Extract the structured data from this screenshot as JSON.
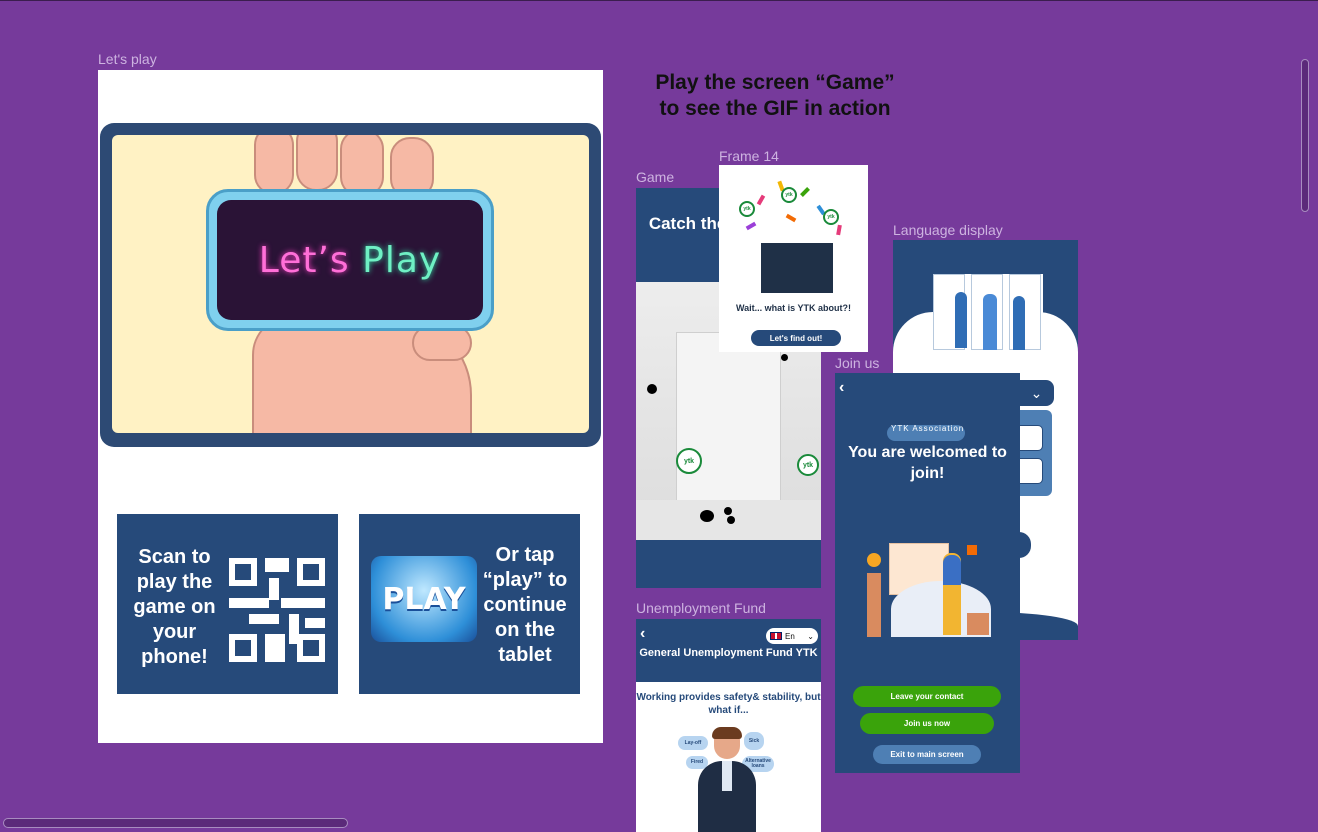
{
  "canvas": {
    "labels": {
      "lets_play": "Let's play",
      "frame14": "Frame 14",
      "game": "Game",
      "language_display": "Language display",
      "join_us": "Join us",
      "unemployment_fund": "Unemployment Fund"
    },
    "heading": "Play the screen “Game” to see the GIF in action"
  },
  "lets_play": {
    "hero_text_1": "Let’s",
    "hero_text_2": "Play",
    "scan_tile": "Scan to play the game on your phone!",
    "tap_tile": "Or tap “play” to continue on the tablet",
    "play_button": "PLAY"
  },
  "game": {
    "title": "Catch the YTK balls",
    "badge": "ytk"
  },
  "frame14": {
    "text": "Wait... what is YTK about?!",
    "button": "Let's find out!"
  },
  "join_us": {
    "association": "YTK Association",
    "title": "You are welcomed to join!",
    "leave_contact": "Leave your contact",
    "join_now": "Join us now",
    "exit": "Exit to main screen"
  },
  "unemployment": {
    "lang": "En",
    "title": "General Unemployment Fund YTK",
    "subtitle": "Working provides safety& stability, but what if...",
    "bubbles": [
      "Lay-off",
      "Sick",
      "Fired",
      "Alternative loans"
    ]
  },
  "colors": {
    "canvas": "#763a9b",
    "navy": "#264a7a",
    "green": "#3aa30b"
  }
}
